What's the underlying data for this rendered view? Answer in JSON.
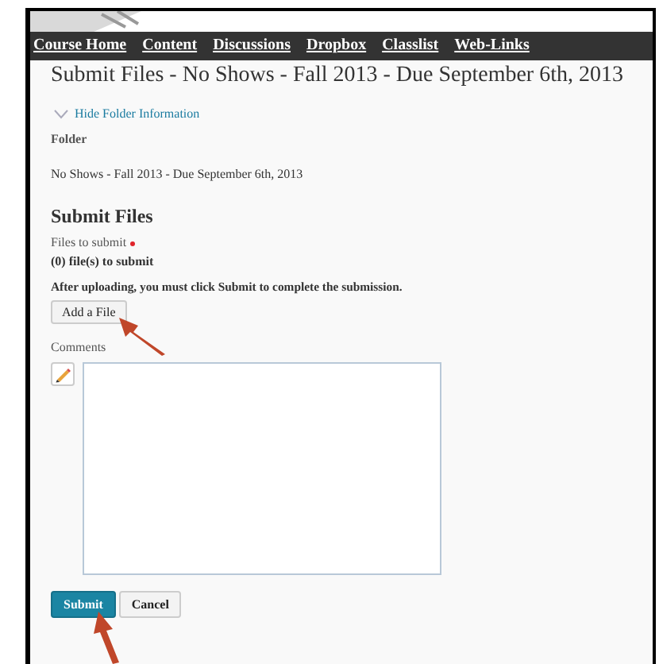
{
  "nav": [
    {
      "label": "Course Home"
    },
    {
      "label": "Content"
    },
    {
      "label": "Discussions"
    },
    {
      "label": "Dropbox"
    },
    {
      "label": "Classlist"
    },
    {
      "label": "Web-Links"
    }
  ],
  "title": "Submit Files - No Shows - Fall 2013 - Due September 6th, 2013",
  "folder_toggle": {
    "label": "Hide Folder Information",
    "expanded": true
  },
  "folder": {
    "label": "Folder",
    "value": "No Shows - Fall 2013 - Due September 6th, 2013"
  },
  "section": {
    "heading": "Submit Files",
    "files_label": "Files to submit",
    "required": true,
    "files_count": "(0) file(s) to submit",
    "instruction": "After uploading, you must click Submit to complete the submission.",
    "add_button": "Add a File",
    "comments_label": "Comments"
  },
  "buttons": [
    {
      "label": "Submit",
      "kind": "primary"
    },
    {
      "label": "Cancel",
      "kind": "secondary"
    }
  ]
}
